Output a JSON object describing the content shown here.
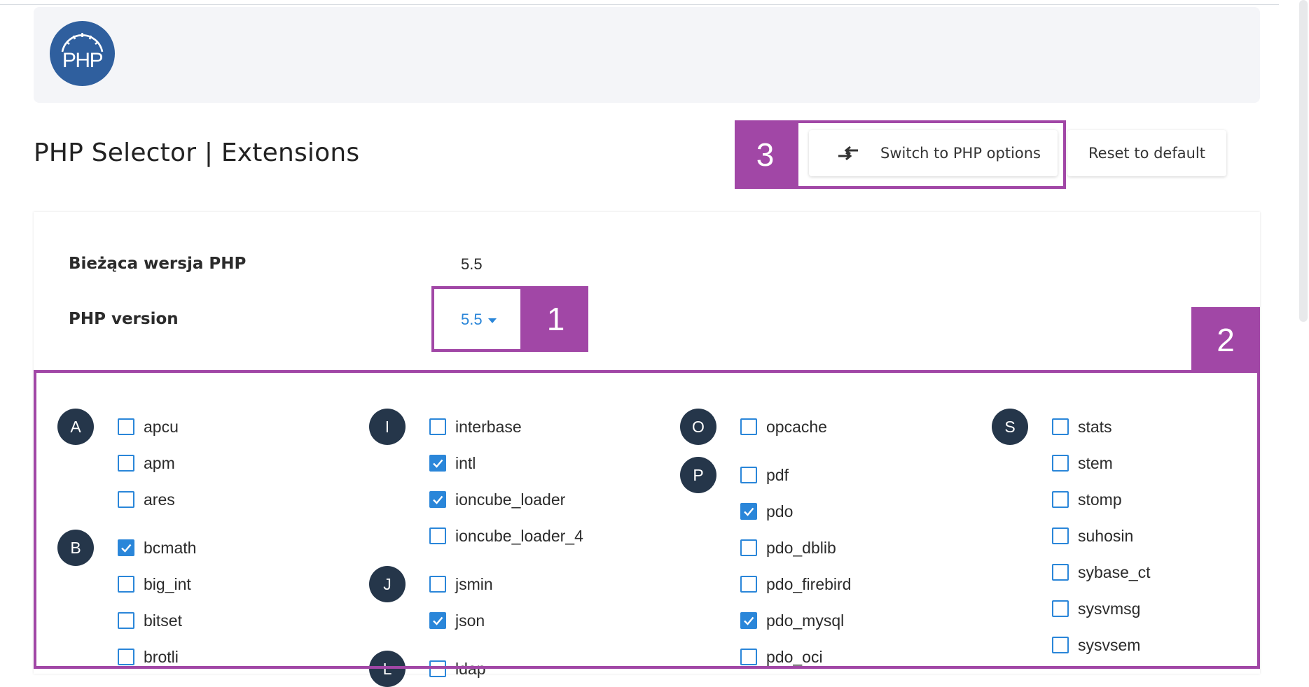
{
  "header": {
    "logo_text": "PHP",
    "title": "PHP Selector | Extensions"
  },
  "toolbar": {
    "switch_label": "Switch to PHP options",
    "reset_label": "Reset to default"
  },
  "settings": {
    "current_version_label": "Bieżąca wersja PHP",
    "current_version_value": "5.5",
    "php_version_label": "PHP version",
    "php_version_selected": "5.5"
  },
  "markers": [
    "1",
    "2",
    "3"
  ],
  "columns": [
    {
      "groups": [
        {
          "letter": "A",
          "items": [
            {
              "name": "apcu",
              "checked": false
            },
            {
              "name": "apm",
              "checked": false
            },
            {
              "name": "ares",
              "checked": false
            }
          ]
        },
        {
          "letter": "B",
          "items": [
            {
              "name": "bcmath",
              "checked": true
            },
            {
              "name": "big_int",
              "checked": false
            },
            {
              "name": "bitset",
              "checked": false
            },
            {
              "name": "brotli",
              "checked": false
            }
          ]
        }
      ]
    },
    {
      "groups": [
        {
          "letter": "I",
          "items": [
            {
              "name": "interbase",
              "checked": false
            },
            {
              "name": "intl",
              "checked": true
            },
            {
              "name": "ioncube_loader",
              "checked": true
            },
            {
              "name": "ioncube_loader_4",
              "checked": false
            }
          ]
        },
        {
          "letter": "J",
          "items": [
            {
              "name": "jsmin",
              "checked": false
            },
            {
              "name": "json",
              "checked": true
            }
          ]
        },
        {
          "letter": "L",
          "items": [
            {
              "name": "ldap",
              "checked": false
            }
          ]
        }
      ]
    },
    {
      "groups": [
        {
          "letter": "O",
          "items": [
            {
              "name": "opcache",
              "checked": false
            }
          ]
        },
        {
          "letter": "P",
          "items": [
            {
              "name": "pdf",
              "checked": false
            },
            {
              "name": "pdo",
              "checked": true
            },
            {
              "name": "pdo_dblib",
              "checked": false
            },
            {
              "name": "pdo_firebird",
              "checked": false
            },
            {
              "name": "pdo_mysql",
              "checked": true
            },
            {
              "name": "pdo_oci",
              "checked": false
            }
          ]
        }
      ]
    },
    {
      "groups": [
        {
          "letter": "S",
          "items": [
            {
              "name": "stats",
              "checked": false
            },
            {
              "name": "stem",
              "checked": false
            },
            {
              "name": "stomp",
              "checked": false
            },
            {
              "name": "suhosin",
              "checked": false
            },
            {
              "name": "sybase_ct",
              "checked": false
            },
            {
              "name": "sysvmsg",
              "checked": false
            },
            {
              "name": "sysvsem",
              "checked": false
            }
          ]
        }
      ]
    }
  ],
  "colors": {
    "accent": "#2a86d9",
    "highlight": "#a147a6",
    "badge": "#25364a"
  }
}
